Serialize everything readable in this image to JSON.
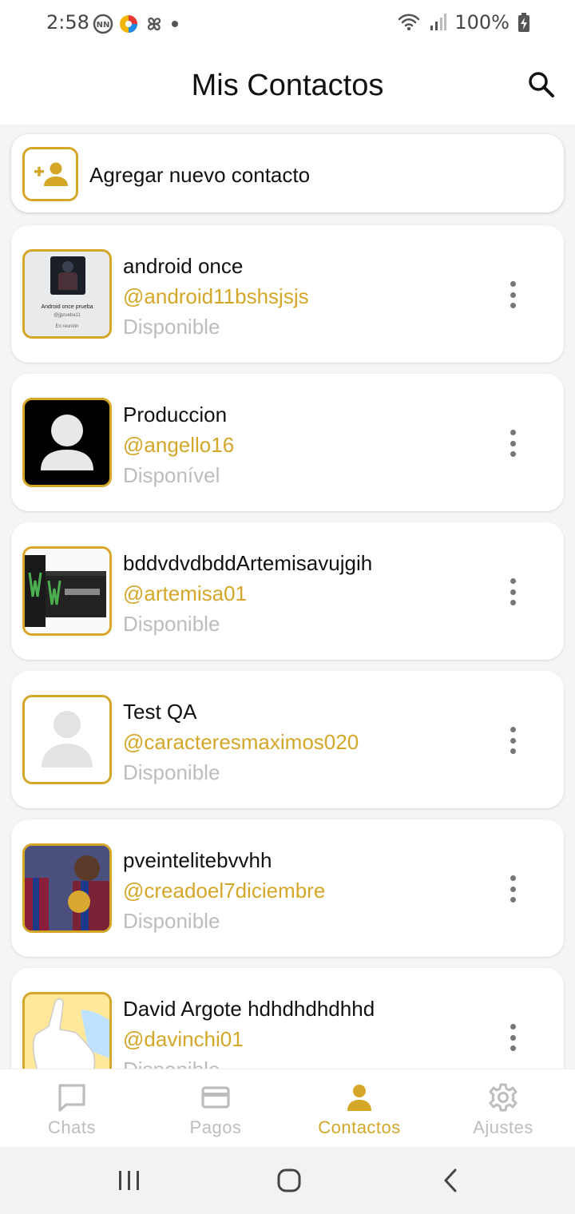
{
  "status_bar": {
    "time": "2:58",
    "battery": "100%"
  },
  "header": {
    "title": "Mis Contactos"
  },
  "add_contact": {
    "label": "Agregar nuevo contacto"
  },
  "contacts": [
    {
      "name": "android once",
      "handle": "@android11bshsjsjs",
      "status": "Disponible",
      "avatar_text": "Android once prueba",
      "avatar_subtext": "@jjprueba11",
      "avatar_meta": "En reunión"
    },
    {
      "name": "Produccion",
      "handle": "@angello16",
      "status": "Disponível"
    },
    {
      "name": "bddvdvdbddArtemisavujgih",
      "handle": "@artemisa01",
      "status": "Disponible"
    },
    {
      "name": "Test QA",
      "handle": "@caracteresmaximos020",
      "status": "Disponible"
    },
    {
      "name": "pveintelitebvvhh",
      "handle": "@creadoel7diciembre",
      "status": "Disponible"
    },
    {
      "name": "David Argote hdhdhdhdhhd",
      "handle": "@davinchi01",
      "status": "Disponible"
    }
  ],
  "bottom_nav": {
    "items": [
      {
        "label": "Chats",
        "icon": "chat-icon"
      },
      {
        "label": "Pagos",
        "icon": "card-icon"
      },
      {
        "label": "Contactos",
        "icon": "person-icon"
      },
      {
        "label": "Ajustes",
        "icon": "gear-icon"
      }
    ],
    "active": "Contactos"
  },
  "colors": {
    "accent": "#d4a728",
    "inactive": "#bdbdbd",
    "background": "#f5f5f5"
  }
}
